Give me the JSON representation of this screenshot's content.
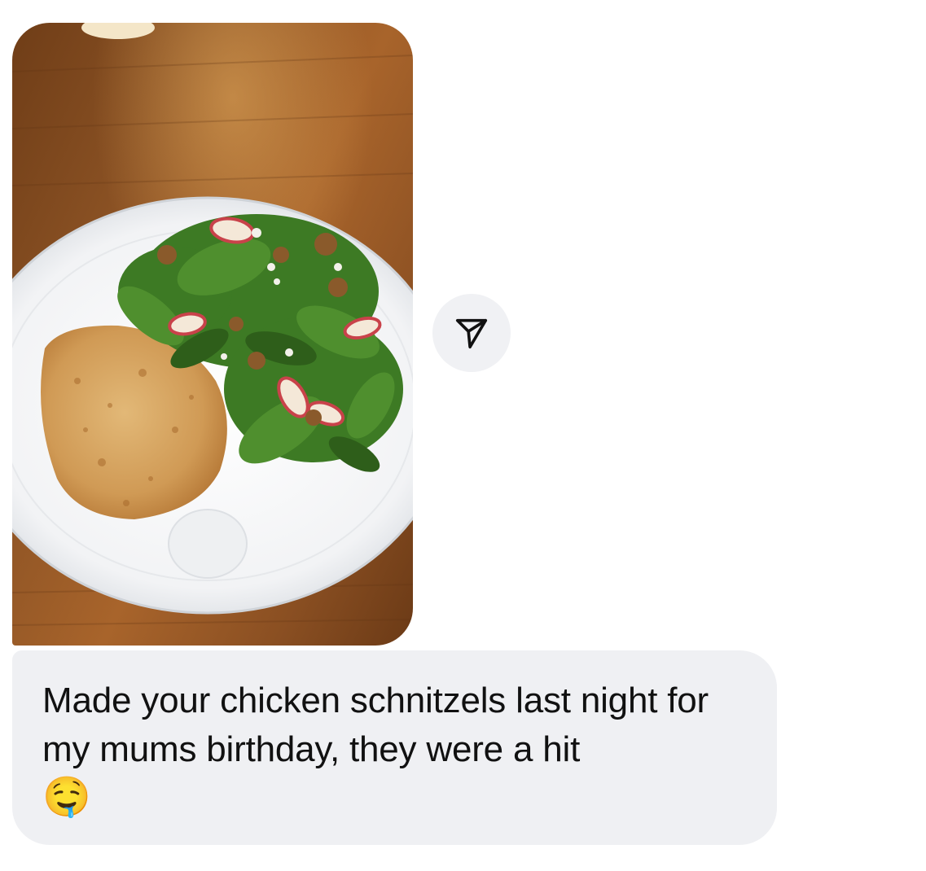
{
  "message": {
    "text": "Made your chicken schnitzels last night for my mums birthday, they were a hit",
    "emoji": "🤤"
  },
  "photo": {
    "icon": "food-photo"
  },
  "actions": {
    "share_icon": "send-icon"
  },
  "colors": {
    "bubble": "#eff0f3",
    "share_button": "#f0f1f4",
    "text": "#111111"
  }
}
